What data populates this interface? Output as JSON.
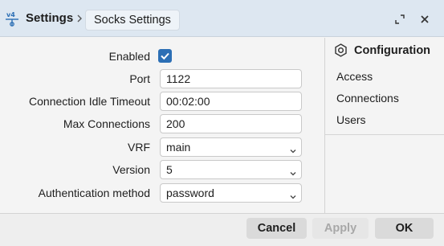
{
  "title": {
    "app_icon": "socks-proxy-icon",
    "main": "Settings",
    "crumb": "Socks Settings"
  },
  "form": {
    "enabled_label": "Enabled",
    "enabled_checked": true,
    "port_label": "Port",
    "port_value": "1122",
    "idle_label": "Connection Idle Timeout",
    "idle_value": "00:02:00",
    "maxconn_label": "Max Connections",
    "maxconn_value": "200",
    "vrf_label": "VRF",
    "vrf_value": "main",
    "version_label": "Version",
    "version_value": "5",
    "auth_label": "Authentication method",
    "auth_value": "password"
  },
  "side": {
    "title": "Configuration",
    "items": [
      "Access",
      "Connections",
      "Users"
    ]
  },
  "footer": {
    "cancel": "Cancel",
    "apply": "Apply",
    "ok": "OK"
  },
  "colors": {
    "titlebar": "#dde7f1",
    "accent": "#2c6fb5",
    "panel": "#f4f4f4"
  }
}
